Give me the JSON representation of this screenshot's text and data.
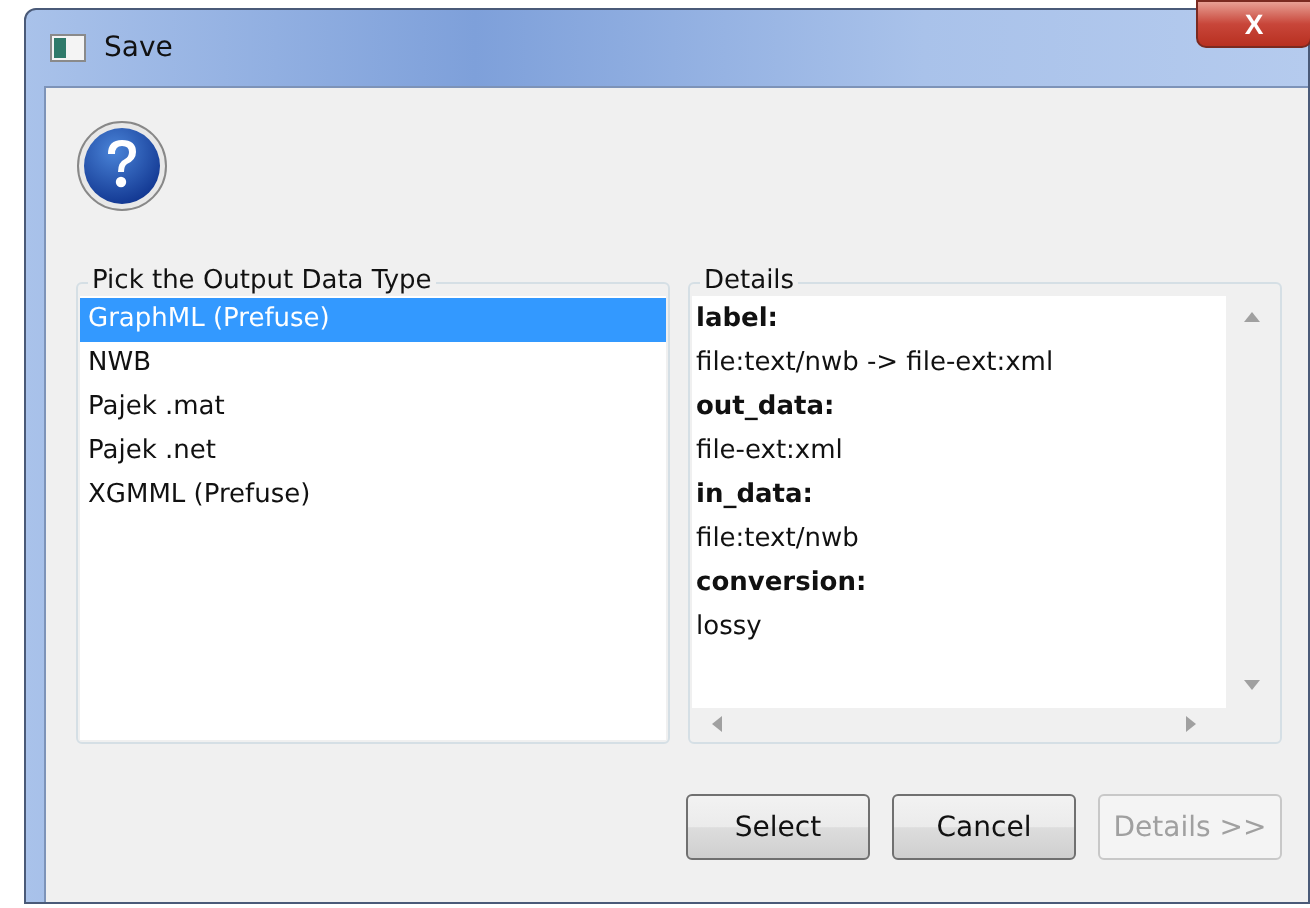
{
  "window": {
    "title": "Save",
    "close_glyph": "X"
  },
  "output_types": {
    "legend": "Pick the Output Data Type",
    "items": [
      {
        "label": "GraphML (Prefuse)",
        "selected": true
      },
      {
        "label": "NWB",
        "selected": false
      },
      {
        "label": "Pajek .mat",
        "selected": false
      },
      {
        "label": "Pajek .net",
        "selected": false
      },
      {
        "label": "XGMML (Prefuse)",
        "selected": false
      }
    ]
  },
  "details": {
    "legend": "Details",
    "lines": [
      {
        "kind": "key",
        "text": "label:"
      },
      {
        "kind": "value",
        "text": "file:text/nwb -> file-ext:xml"
      },
      {
        "kind": "key",
        "text": "out_data:"
      },
      {
        "kind": "value",
        "text": "file-ext:xml"
      },
      {
        "kind": "key",
        "text": "in_data:"
      },
      {
        "kind": "value",
        "text": "file:text/nwb"
      },
      {
        "kind": "key",
        "text": "conversion:"
      },
      {
        "kind": "value",
        "text": "lossy"
      }
    ]
  },
  "buttons": [
    {
      "label": "Select",
      "disabled": false
    },
    {
      "label": "Cancel",
      "disabled": false
    },
    {
      "label": "Details >>",
      "disabled": true
    }
  ]
}
